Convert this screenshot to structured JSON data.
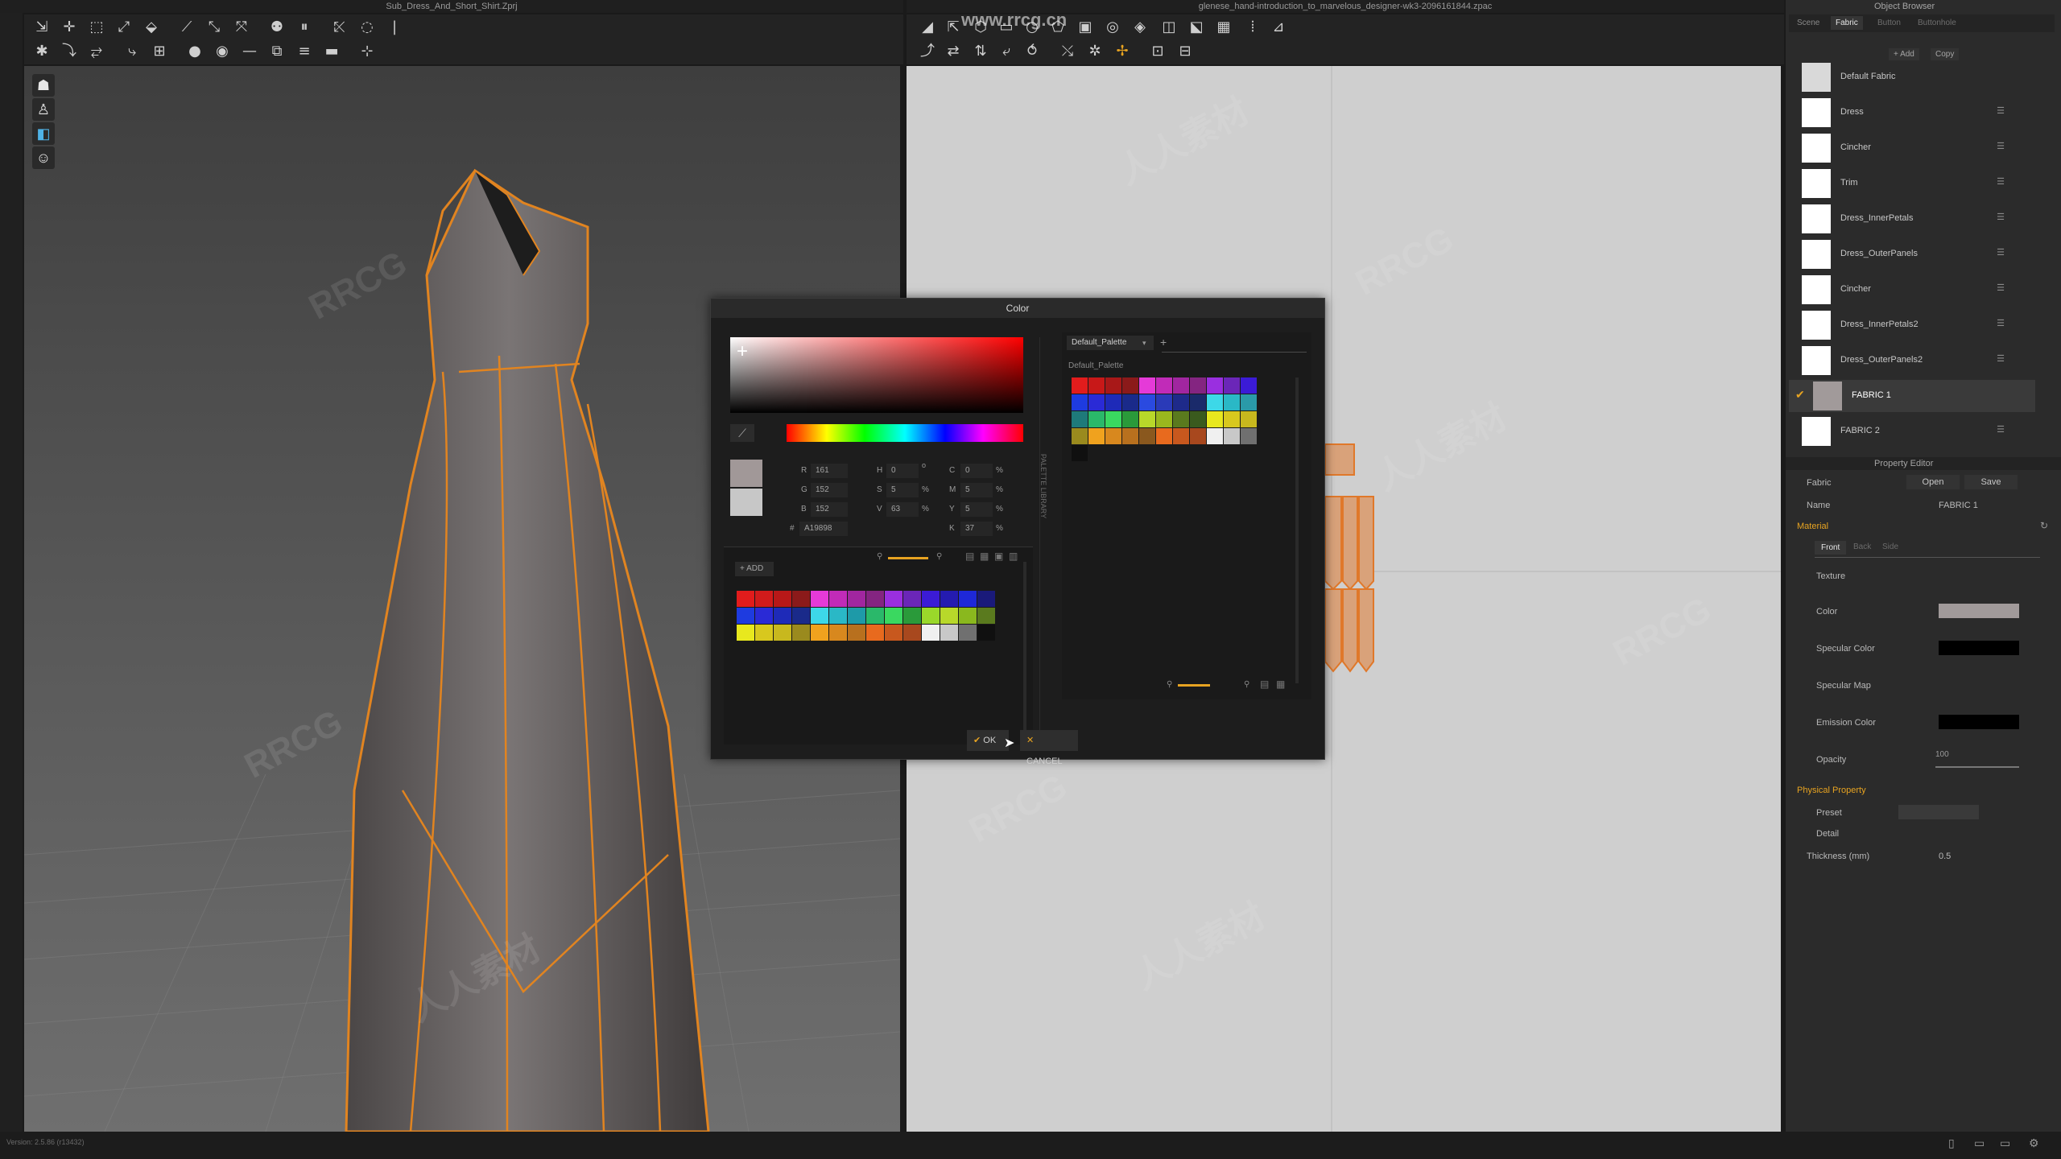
{
  "windows": {
    "left_title": "Sub_Dress_And_Short_Shirt.Zprj",
    "right_title": "glenese_hand-introduction_to_marvelous_designer-wk3-2096161844.zpac",
    "site_watermark": "www.rrcg.cn",
    "watermark_text_a": "RRCG",
    "watermark_text_b": "人人素材"
  },
  "object_browser": {
    "title": "Object Browser",
    "tabs": [
      "Scene",
      "Fabric",
      "Button",
      "Buttonhole"
    ],
    "active_tab": "Fabric",
    "add_label": "+ Add",
    "copy_label": "Copy",
    "items": [
      {
        "label": "Default Fabric",
        "color": "#d9d9d9"
      },
      {
        "label": "Dress",
        "color": "#ffffff"
      },
      {
        "label": "Cincher",
        "color": "#ffffff"
      },
      {
        "label": "Trim",
        "color": "#ffffff"
      },
      {
        "label": "Dress_InnerPetals",
        "color": "#ffffff"
      },
      {
        "label": "Dress_OuterPanels",
        "color": "#ffffff"
      },
      {
        "label": "Cincher",
        "color": "#ffffff"
      },
      {
        "label": "Dress_InnerPetals2",
        "color": "#ffffff"
      },
      {
        "label": "Dress_OuterPanels2",
        "color": "#ffffff"
      },
      {
        "label": "FABRIC 1",
        "color": "#a19a9a",
        "selected": true
      },
      {
        "label": "FABRIC 2",
        "color": "#ffffff"
      }
    ]
  },
  "property_editor": {
    "title": "Property Editor",
    "fabric_label": "Fabric",
    "open_label": "Open",
    "save_label": "Save",
    "name_label": "Name",
    "name_value": "FABRIC 1",
    "material_section": "Material",
    "sides": [
      "Front",
      "Back",
      "Side"
    ],
    "texture_label": "Texture",
    "color_label": "Color",
    "color_value": "#a19a9a",
    "specular_color_label": "Specular Color",
    "specular_map_label": "Specular Map",
    "emission_color_label": "Emission Color",
    "opacity_label": "Opacity",
    "opacity_value": "100",
    "physical_section": "Physical Property",
    "preset_label": "Preset",
    "detail_label": "Detail",
    "thickness_label": "Thickness (mm)",
    "thickness_value": "0.5"
  },
  "color_dialog": {
    "title": "Color",
    "r_label": "R",
    "r_value": "161",
    "g_label": "G",
    "g_value": "152",
    "b_label": "B",
    "b_value": "152",
    "hex_label": "#",
    "hex_value": "A19898",
    "h_label": "H",
    "h_value": "0",
    "s_label": "S",
    "s_value": "5",
    "v_label": "V",
    "v_value": "63",
    "c_label": "C",
    "c_value": "0",
    "m_label": "M",
    "m_value": "5",
    "y_label": "Y",
    "y_value": "5",
    "k_label": "K",
    "k_value": "37",
    "deg": "o",
    "pct": "%",
    "add_label": "ADD",
    "palette_library_label": "PALETTE LIBRARY",
    "palette_name": "Default_Palette",
    "palette_sub": "Default_Palette",
    "ok_label": "OK",
    "cancel_label": "CANCEL",
    "current_color": "#a19898",
    "previous_color": "#c7c7c7"
  },
  "status": {
    "version": "Version: 2.5.86    (r13432)"
  }
}
